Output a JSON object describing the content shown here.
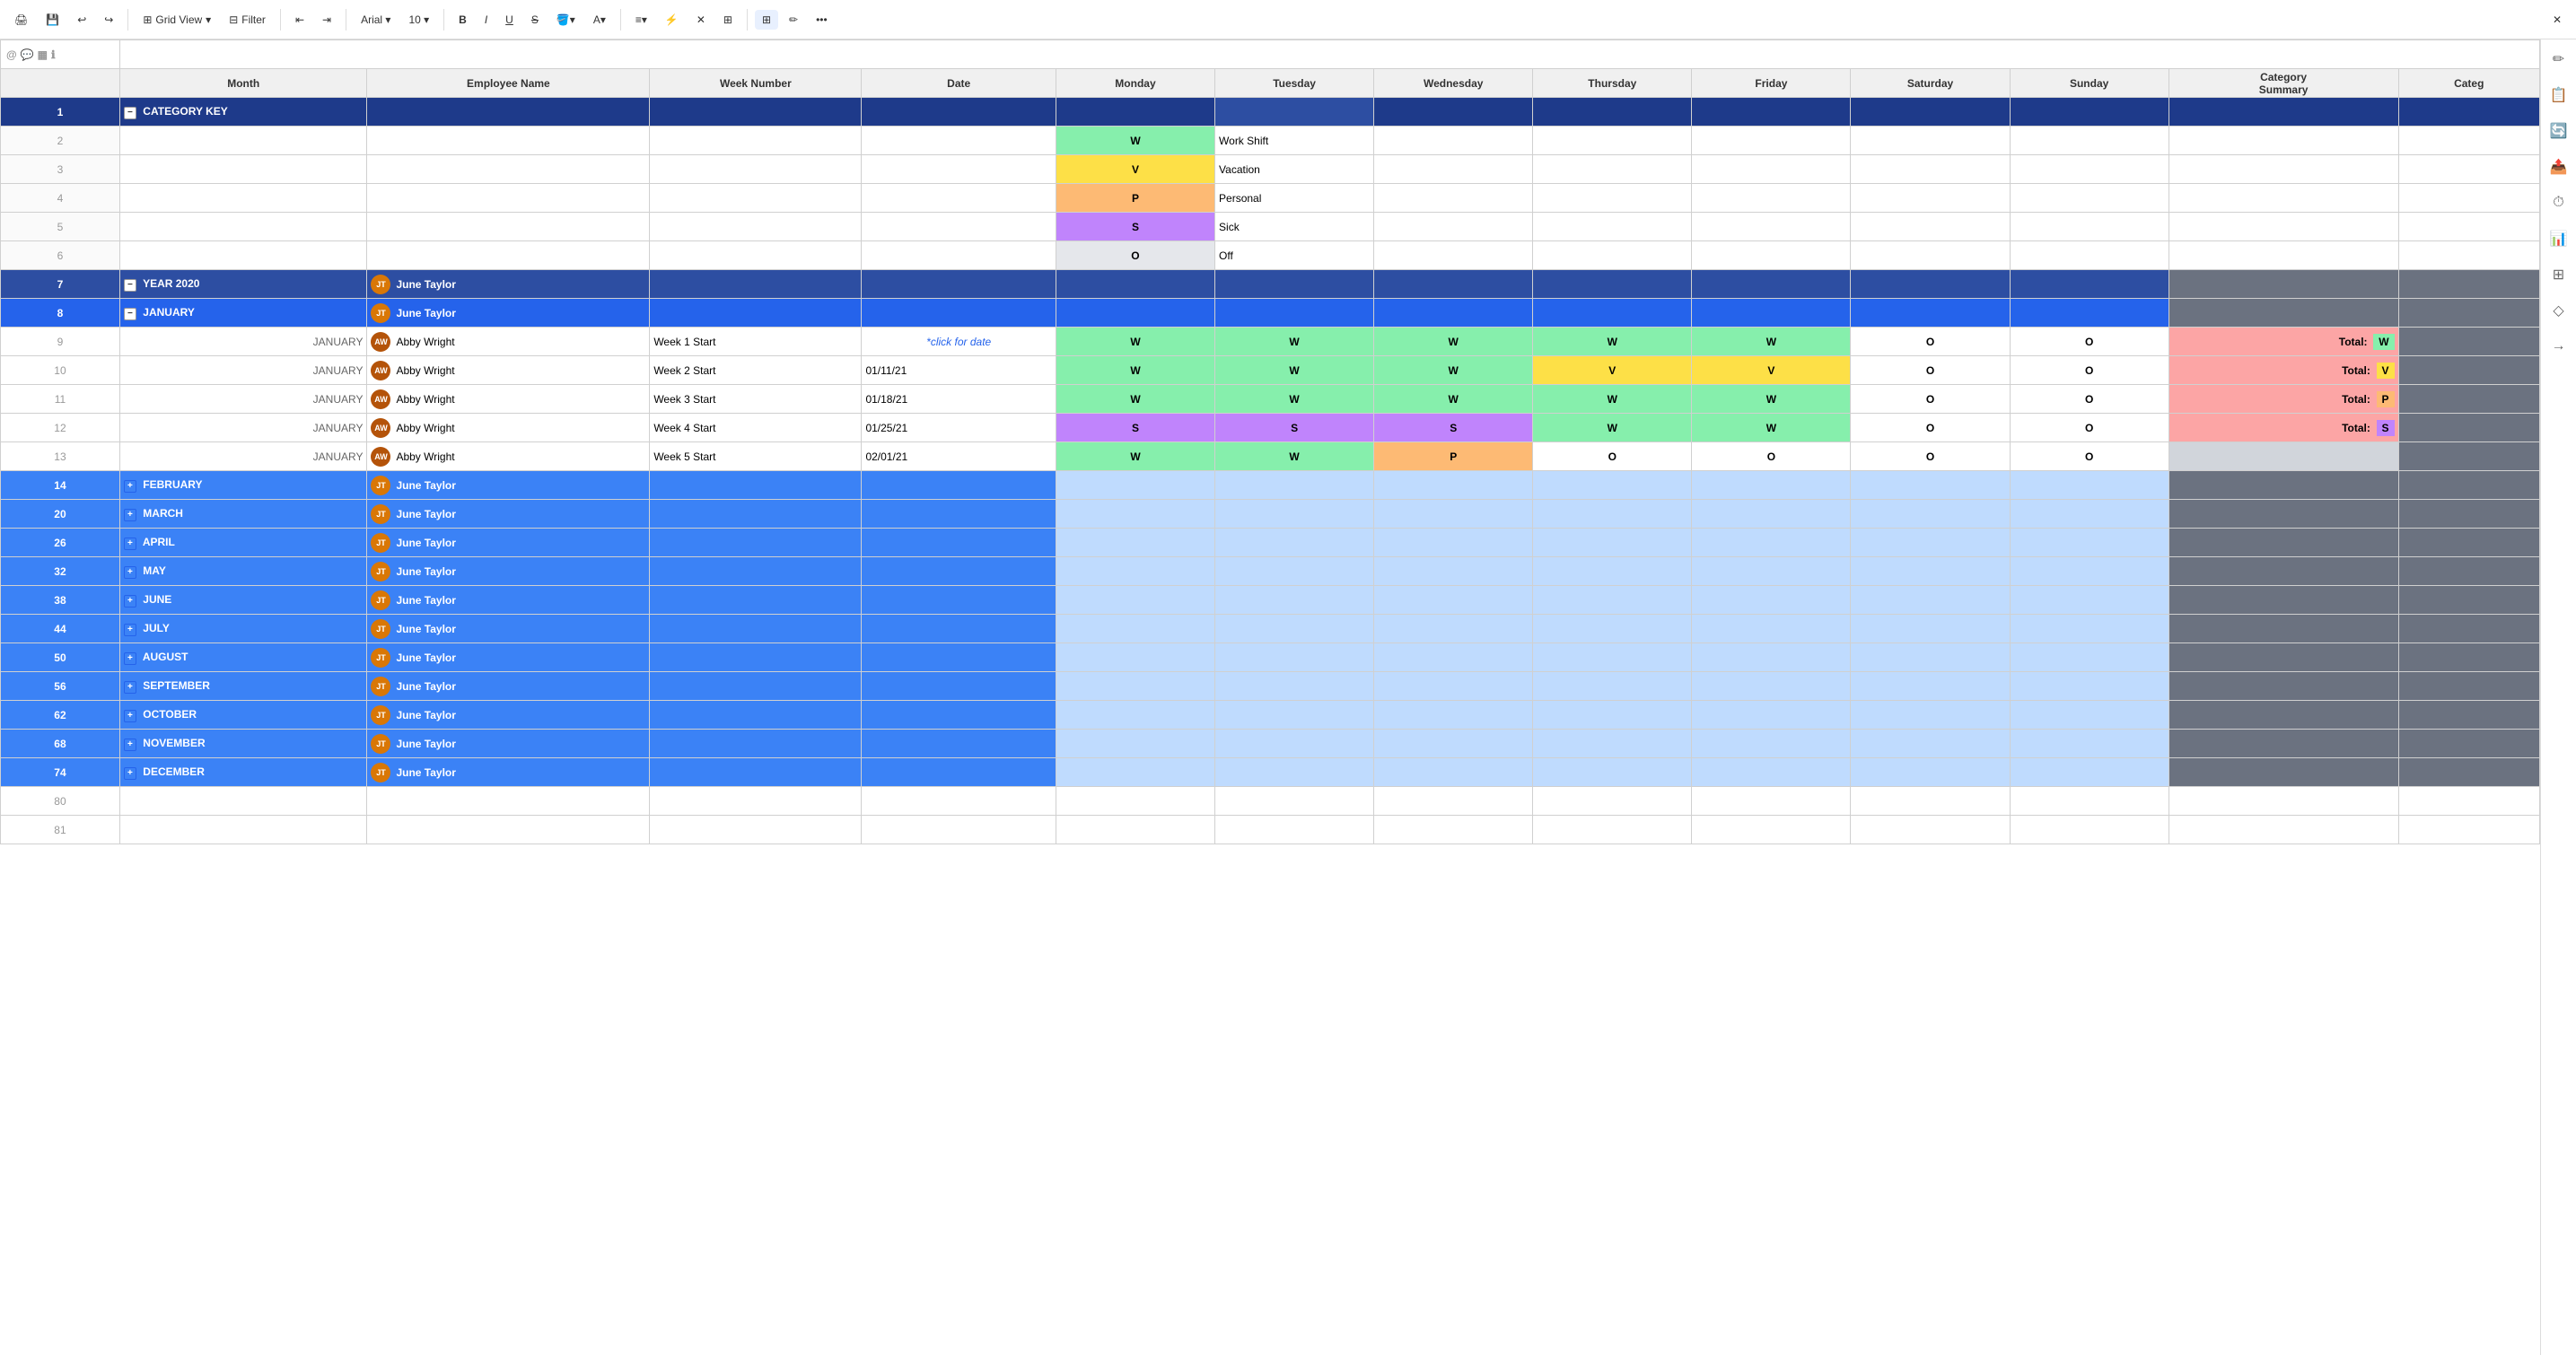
{
  "toolbar": {
    "items": [
      {
        "label": "⊞",
        "name": "print-icon"
      },
      {
        "label": "🖨",
        "name": "save-icon"
      },
      {
        "label": "↩",
        "name": "undo-icon"
      },
      {
        "label": "↪",
        "name": "redo-icon"
      },
      {
        "label": "⊞ Grid View ▾",
        "name": "view-selector"
      },
      {
        "label": "⊟ Filter",
        "name": "filter-btn"
      },
      {
        "label": "⇤",
        "name": "indent-decrease"
      },
      {
        "label": "⇥",
        "name": "indent-increase"
      },
      {
        "label": "Arial ▾",
        "name": "font-selector"
      },
      {
        "label": "10 ▾",
        "name": "font-size"
      },
      {
        "label": "B",
        "name": "bold-btn"
      },
      {
        "label": "I",
        "name": "italic-btn"
      },
      {
        "label": "U",
        "name": "underline-btn"
      },
      {
        "label": "S̶",
        "name": "strikethrough-btn"
      },
      {
        "label": "🪣▾",
        "name": "fill-color"
      },
      {
        "label": "A▾",
        "name": "text-color"
      },
      {
        "label": "≡▾",
        "name": "align-btn"
      },
      {
        "label": "⚡",
        "name": "formula-btn"
      },
      {
        "label": "✕",
        "name": "clear-btn"
      },
      {
        "label": "⊞",
        "name": "grid-btn-active"
      },
      {
        "label": "✏",
        "name": "edit-btn"
      },
      {
        "label": "•••",
        "name": "more-btn"
      }
    ]
  },
  "columns": {
    "headers": [
      "Month",
      "Employee Name",
      "Week Number",
      "Date",
      "Monday",
      "Tuesday",
      "Wednesday",
      "Thursday",
      "Friday",
      "Saturday",
      "Sunday",
      "Category Summary",
      "Categ"
    ]
  },
  "legend": {
    "items": [
      {
        "symbol": "W",
        "label": "Work Shift",
        "color": "w"
      },
      {
        "symbol": "V",
        "label": "Vacation",
        "color": "v"
      },
      {
        "symbol": "P",
        "label": "Personal",
        "color": "p"
      },
      {
        "symbol": "S",
        "label": "Sick",
        "color": "s"
      },
      {
        "symbol": "O",
        "label": "Off",
        "color": "o"
      }
    ]
  },
  "rows": {
    "category_key": "CATEGORY KEY",
    "year": "YEAR 2020",
    "january_header": "JANUARY",
    "weeks": [
      {
        "row": 9,
        "month": "JANUARY",
        "employee": "Abby Wright",
        "week": "Week 1 Start",
        "date": "*click for date",
        "date_is_link": true,
        "mon": "W",
        "tue": "W",
        "wed": "W",
        "thu": "W",
        "fri": "W",
        "sat": "O",
        "sun": "O",
        "total": "W"
      },
      {
        "row": 10,
        "month": "JANUARY",
        "employee": "Abby Wright",
        "week": "Week 2 Start",
        "date": "01/11/21",
        "date_is_link": false,
        "mon": "W",
        "tue": "W",
        "wed": "W",
        "thu": "V",
        "fri": "V",
        "sat": "O",
        "sun": "O",
        "total": "V"
      },
      {
        "row": 11,
        "month": "JANUARY",
        "employee": "Abby Wright",
        "week": "Week 3 Start",
        "date": "01/18/21",
        "date_is_link": false,
        "mon": "W",
        "tue": "W",
        "wed": "W",
        "thu": "W",
        "fri": "W",
        "sat": "O",
        "sun": "O",
        "total": "P"
      },
      {
        "row": 12,
        "month": "JANUARY",
        "employee": "Abby Wright",
        "week": "Week 4 Start",
        "date": "01/25/21",
        "date_is_link": false,
        "mon": "S",
        "tue": "S",
        "wed": "S",
        "thu": "W",
        "fri": "W",
        "sat": "O",
        "sun": "O",
        "total": "S"
      },
      {
        "row": 13,
        "month": "JANUARY",
        "employee": "Abby Wright",
        "week": "Week 5 Start",
        "date": "02/01/21",
        "date_is_link": false,
        "mon": "W",
        "tue": "W",
        "wed": "P",
        "thu": "O",
        "fri": "O",
        "sat": "O",
        "sun": "O",
        "total": ""
      }
    ],
    "collapsed_months": [
      {
        "row": 14,
        "label": "FEBRUARY"
      },
      {
        "row": 20,
        "label": "MARCH"
      },
      {
        "row": 26,
        "label": "APRIL"
      },
      {
        "row": 32,
        "label": "MAY"
      },
      {
        "row": 38,
        "label": "JUNE"
      },
      {
        "row": 44,
        "label": "JULY"
      },
      {
        "row": 50,
        "label": "AUGUST"
      },
      {
        "row": 56,
        "label": "SEPTEMBER"
      },
      {
        "row": 62,
        "label": "OCTOBER"
      },
      {
        "row": 68,
        "label": "NOVEMBER"
      },
      {
        "row": 74,
        "label": "DECEMBER"
      }
    ]
  },
  "right_sidebar_icons": [
    "✏",
    "📋",
    "🔄",
    "📤",
    "⏱",
    "📊",
    "⚙",
    "◇",
    "→"
  ],
  "june_taylor": "June Taylor",
  "abby_wright": "Abby Wright"
}
